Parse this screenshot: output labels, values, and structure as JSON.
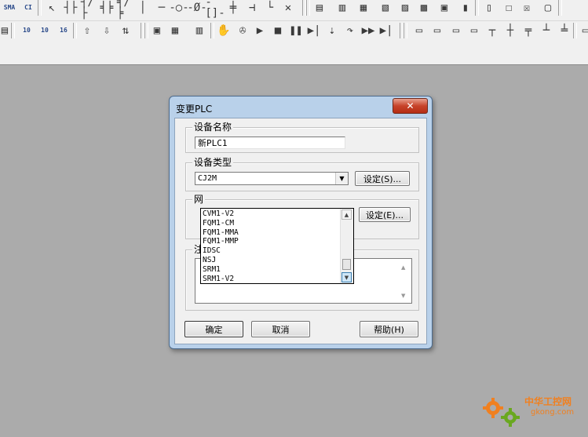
{
  "toolbar": {
    "row1": [
      {
        "name": "sma-icon",
        "glyph": "SMA"
      },
      {
        "name": "ci-icon",
        "glyph": "CI"
      },
      {
        "name": "pointer-icon",
        "glyph": "↖"
      },
      {
        "name": "no-contact-icon",
        "glyph": "┤├"
      },
      {
        "name": "nc-contact-icon",
        "glyph": "┤/├"
      },
      {
        "name": "parallel-contact-icon",
        "glyph": "╡╞"
      },
      {
        "name": "parallel-nc-contact-icon",
        "glyph": "╡/╞"
      },
      {
        "name": "vertical-line-icon",
        "glyph": "│"
      },
      {
        "name": "horizontal-line-icon",
        "glyph": "─"
      },
      {
        "name": "coil-icon",
        "glyph": "-○-"
      },
      {
        "name": "nc-coil-icon",
        "glyph": "-Ø-"
      },
      {
        "name": "instruction-icon",
        "glyph": "-[]-"
      },
      {
        "name": "instruction-block-icon",
        "glyph": "╪"
      },
      {
        "name": "branch-icon",
        "glyph": "⊣"
      },
      {
        "name": "line-connect-icon",
        "glyph": "└"
      },
      {
        "name": "delete-line-icon",
        "glyph": "✕"
      },
      {
        "name": "program-icon",
        "glyph": "▤"
      },
      {
        "name": "section-icon",
        "glyph": "▥"
      },
      {
        "name": "memory-icon",
        "glyph": "▦"
      },
      {
        "name": "table-icon-a",
        "glyph": "▧"
      },
      {
        "name": "table-icon-b",
        "glyph": "▨"
      },
      {
        "name": "table-icon-c",
        "glyph": "▩"
      },
      {
        "name": "table-icon-d",
        "glyph": "▣"
      },
      {
        "name": "window-icon-a",
        "glyph": "▮"
      },
      {
        "name": "window-icon-b",
        "glyph": "▯"
      },
      {
        "name": "window-icon-c",
        "glyph": "☐"
      },
      {
        "name": "window-icon-d",
        "glyph": "☒"
      },
      {
        "name": "window-icon-e",
        "glyph": "▢"
      }
    ],
    "row2": [
      {
        "name": "ladder-icon",
        "glyph": "▤"
      },
      {
        "name": "radix-10-icon",
        "glyph": "10"
      },
      {
        "name": "radix-10s-icon",
        "glyph": "10"
      },
      {
        "name": "radix-16-icon",
        "glyph": "16"
      },
      {
        "name": "upload-icon",
        "glyph": "⇧"
      },
      {
        "name": "download-icon",
        "glyph": "⇩"
      },
      {
        "name": "compare-icon",
        "glyph": "⇅"
      },
      {
        "name": "online-icon",
        "glyph": "▣"
      },
      {
        "name": "monitor-icon",
        "glyph": "▦"
      },
      {
        "name": "edit-online-icon",
        "glyph": "▥"
      },
      {
        "name": "force-on-icon",
        "glyph": "✋"
      },
      {
        "name": "force-off-icon",
        "glyph": "✇"
      },
      {
        "name": "run-icon",
        "glyph": "▶"
      },
      {
        "name": "stop-icon",
        "glyph": "■"
      },
      {
        "name": "pause-icon",
        "glyph": "❚❚"
      },
      {
        "name": "step-icon",
        "glyph": "▶|"
      },
      {
        "name": "step-into-icon",
        "glyph": "⇣"
      },
      {
        "name": "step-over-icon",
        "glyph": "↷"
      },
      {
        "name": "fast-forward-icon",
        "glyph": "▶▶"
      },
      {
        "name": "step-end-icon",
        "glyph": "▶|"
      },
      {
        "name": "io-icon-a",
        "glyph": "▭"
      },
      {
        "name": "io-icon-b",
        "glyph": "▭"
      },
      {
        "name": "io-icon-c",
        "glyph": "▭"
      },
      {
        "name": "io-icon-d",
        "glyph": "▭"
      },
      {
        "name": "rung-icon-a",
        "glyph": "┬"
      },
      {
        "name": "rung-icon-b",
        "glyph": "┼"
      },
      {
        "name": "rung-icon-c",
        "glyph": "╤"
      },
      {
        "name": "rung-icon-d",
        "glyph": "┴"
      },
      {
        "name": "rung-icon-e",
        "glyph": "╧"
      },
      {
        "name": "extra-icon",
        "glyph": "▭"
      }
    ]
  },
  "dialog": {
    "title": "变更PLC",
    "close_glyph": "✕",
    "device_name": {
      "label": "设备名称",
      "value": "新PLC1"
    },
    "device_type": {
      "label": "设备类型",
      "selected": "CJ2M",
      "settings_button": "设定(S)...",
      "dropdown_items": [
        "CVM1-V2",
        "FQM1-CM",
        "FQM1-MMA",
        "FQM1-MMP",
        "IDSC",
        "NSJ",
        "SRM1",
        "SRM1-V2"
      ]
    },
    "network": {
      "label": "网",
      "settings_button": "设定(E)..."
    },
    "comment": {
      "label": "注"
    },
    "buttons": {
      "ok": "确定",
      "cancel": "取消",
      "help": "帮助(H)"
    }
  },
  "watermark": {
    "line1": "中华工控网",
    "line2": "gkong.com"
  },
  "colors": {
    "desktop": "#ababab",
    "toolbar": "#f0f0f0",
    "dialog_frame": "#b9d1ea",
    "close": "#c7432a",
    "watermark_orange": "#f08020",
    "watermark_green": "#6aa820"
  }
}
